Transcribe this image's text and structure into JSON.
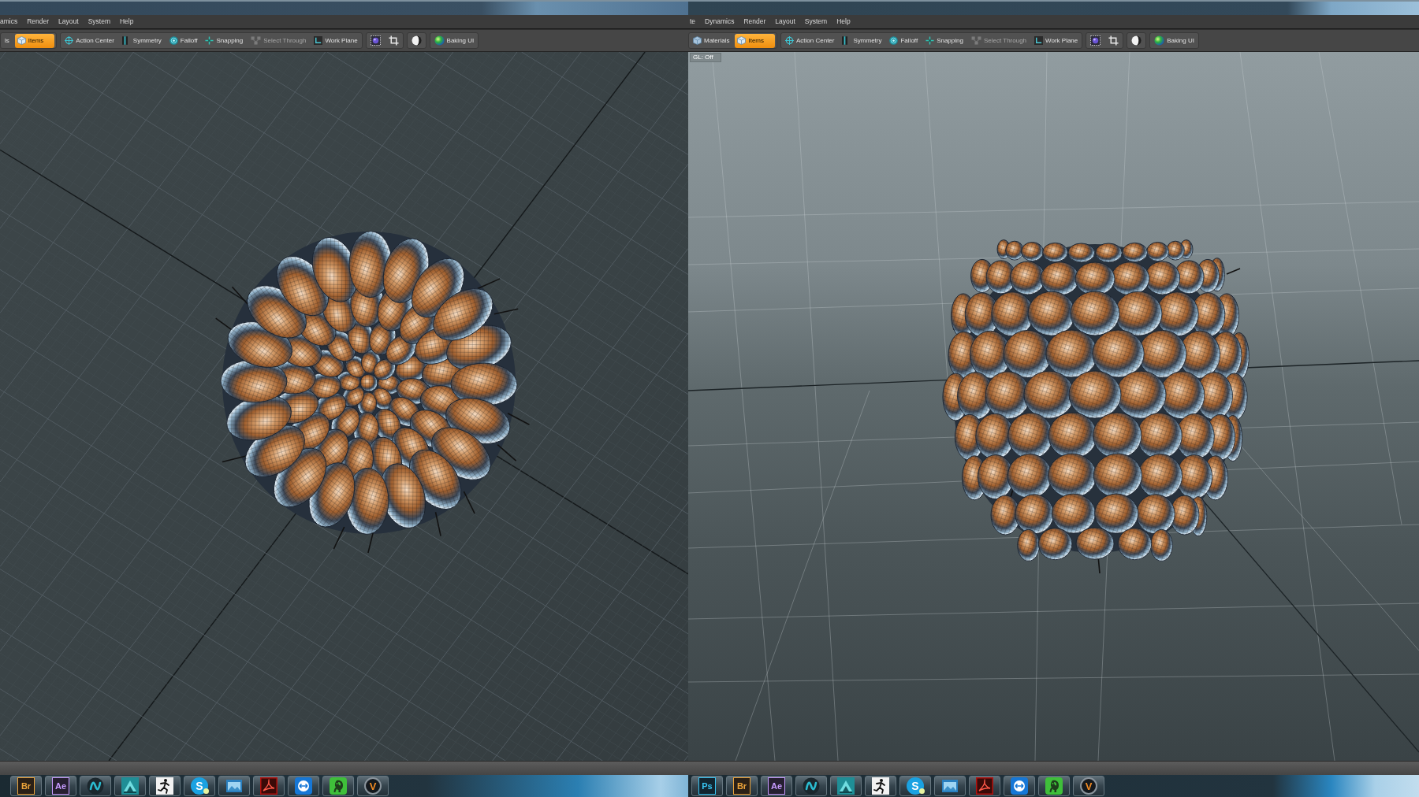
{
  "screens": [
    {
      "menu": [
        "amics",
        "Render",
        "Layout",
        "System",
        "Help"
      ],
      "toolbar": [
        {
          "buttons": [
            {
              "kind": "text",
              "label": "ls",
              "selected": false,
              "disabled": false
            },
            {
              "kind": "cube",
              "label": "Items",
              "selected": true,
              "disabled": false
            }
          ]
        },
        {
          "buttons": [
            {
              "kind": "target",
              "label": "Action Center",
              "selected": false,
              "disabled": false
            },
            {
              "kind": "split",
              "label": "Symmetry",
              "selected": false,
              "disabled": false
            },
            {
              "kind": "ring",
              "label": "Falloff",
              "selected": false,
              "disabled": false
            },
            {
              "kind": "cross",
              "label": "Snapping",
              "selected": false,
              "disabled": false
            },
            {
              "kind": "cubes",
              "label": "Select Through",
              "selected": false,
              "disabled": true
            },
            {
              "kind": "corner",
              "label": "Work Plane",
              "selected": false,
              "disabled": false
            }
          ]
        },
        {
          "buttons": [
            {
              "kind": "frame",
              "selected": false,
              "disabled": false
            },
            {
              "kind": "crop",
              "selected": false,
              "disabled": false
            }
          ]
        },
        {
          "buttons": [
            {
              "kind": "shade",
              "selected": false,
              "disabled": false
            }
          ]
        },
        {
          "buttons": [
            {
              "kind": "ball",
              "label": "Baking UI",
              "selected": false,
              "disabled": false
            }
          ]
        }
      ],
      "viewport": {
        "kind": "top"
      },
      "taskbar": [
        {
          "kind": "letters",
          "label": "Br",
          "color": "#eda43a"
        },
        {
          "kind": "letters",
          "label": "Ae",
          "color": "#c79bff"
        },
        {
          "kind": "knot"
        },
        {
          "kind": "house"
        },
        {
          "kind": "figure"
        },
        {
          "kind": "bubble",
          "label": "S"
        },
        {
          "kind": "window"
        },
        {
          "kind": "swirl"
        },
        {
          "kind": "arrows"
        },
        {
          "kind": "elephant"
        },
        {
          "kind": "ring",
          "label": "V"
        }
      ]
    },
    {
      "menu": [
        "te",
        "Dynamics",
        "Render",
        "Layout",
        "System",
        "Help"
      ],
      "toolbar": [
        {
          "buttons": [
            {
              "kind": "shield",
              "label": "Materials",
              "selected": false,
              "disabled": false
            },
            {
              "kind": "cube",
              "label": "Items",
              "selected": true,
              "disabled": false
            }
          ]
        },
        {
          "buttons": [
            {
              "kind": "target",
              "label": "Action Center",
              "selected": false,
              "disabled": false
            },
            {
              "kind": "split",
              "label": "Symmetry",
              "selected": false,
              "disabled": false
            },
            {
              "kind": "ring",
              "label": "Falloff",
              "selected": false,
              "disabled": false
            },
            {
              "kind": "cross",
              "label": "Snapping",
              "selected": false,
              "disabled": false
            },
            {
              "kind": "cubes",
              "label": "Select Through",
              "selected": false,
              "disabled": true
            },
            {
              "kind": "corner",
              "label": "Work Plane",
              "selected": false,
              "disabled": false
            }
          ]
        },
        {
          "buttons": [
            {
              "kind": "frame",
              "selected": false,
              "disabled": false
            },
            {
              "kind": "crop",
              "selected": false,
              "disabled": false
            }
          ]
        },
        {
          "buttons": [
            {
              "kind": "shade",
              "selected": false,
              "disabled": false
            }
          ]
        },
        {
          "buttons": [
            {
              "kind": "ball",
              "label": "Baking UI",
              "selected": false,
              "disabled": false
            }
          ]
        }
      ],
      "viewport": {
        "kind": "side",
        "label": "GL: Off"
      },
      "taskbar": [
        {
          "kind": "letters",
          "label": "Ps",
          "color": "#38c4f2"
        },
        {
          "kind": "letters",
          "label": "Br",
          "color": "#eda43a"
        },
        {
          "kind": "letters",
          "label": "Ae",
          "color": "#c79bff"
        },
        {
          "kind": "knot"
        },
        {
          "kind": "house"
        },
        {
          "kind": "figure"
        },
        {
          "kind": "bubble",
          "label": "S"
        },
        {
          "kind": "window"
        },
        {
          "kind": "swirl"
        },
        {
          "kind": "arrows"
        },
        {
          "kind": "elephant"
        },
        {
          "kind": "ring",
          "label": "V"
        }
      ]
    }
  ]
}
